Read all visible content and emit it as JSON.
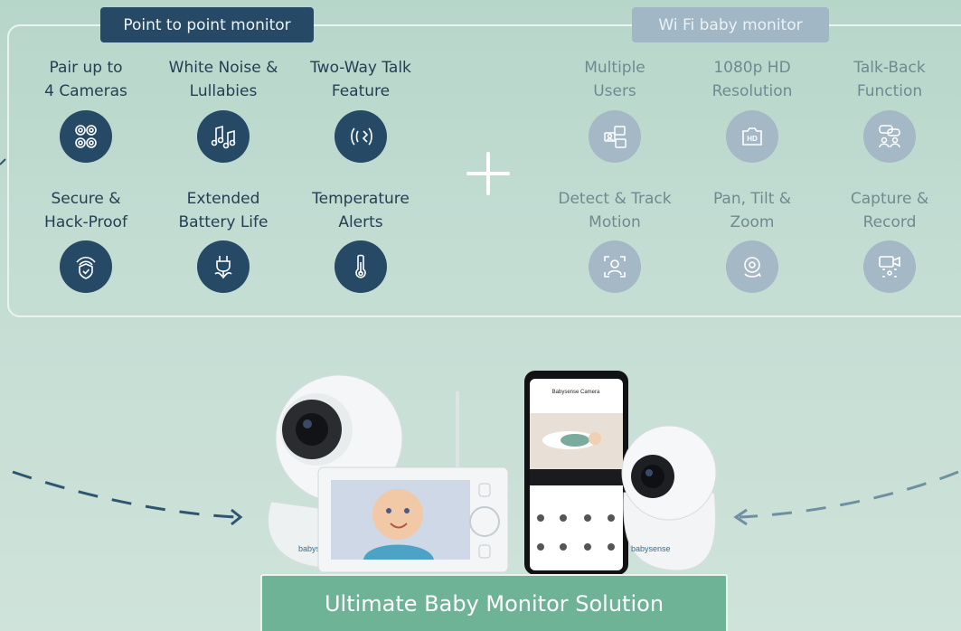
{
  "tags": {
    "point_to_point": "Point to point monitor",
    "wifi": "Wi Fi baby monitor"
  },
  "point_to_point_features": [
    {
      "label": "Pair up to\n4 Cameras",
      "icon": "multi-camera-icon"
    },
    {
      "label": "White Noise &\nLullabies",
      "icon": "music-notes-icon"
    },
    {
      "label": "Two-Way Talk\nFeature",
      "icon": "two-way-talk-icon"
    },
    {
      "label": "Secure &\nHack-Proof",
      "icon": "secure-shield-icon"
    },
    {
      "label": "Extended\nBattery Life",
      "icon": "plug-battery-icon"
    },
    {
      "label": "Temperature\nAlerts",
      "icon": "thermometer-icon"
    }
  ],
  "wifi_features": [
    {
      "label": "Multiple\nUsers",
      "icon": "multiple-users-icon"
    },
    {
      "label": "1080p HD\nResolution",
      "icon": "hd-camera-icon"
    },
    {
      "label": "Talk-Back\nFunction",
      "icon": "talk-back-icon"
    },
    {
      "label": "Detect & Track\nMotion",
      "icon": "motion-detect-icon"
    },
    {
      "label": "Pan, Tilt &\nZoom",
      "icon": "pan-tilt-zoom-icon"
    },
    {
      "label": "Capture &\nRecord",
      "icon": "capture-record-icon"
    }
  ],
  "products": {
    "camera_brand": "babysense",
    "phone_app_title": "Babysense Camera"
  },
  "banner": "Ultimate Baby Monitor Solution",
  "colors": {
    "background": "#c3ddd3",
    "dark_navy": "#264a66",
    "muted_blue": "#a4b8c5",
    "banner_green": "#6fb396"
  }
}
